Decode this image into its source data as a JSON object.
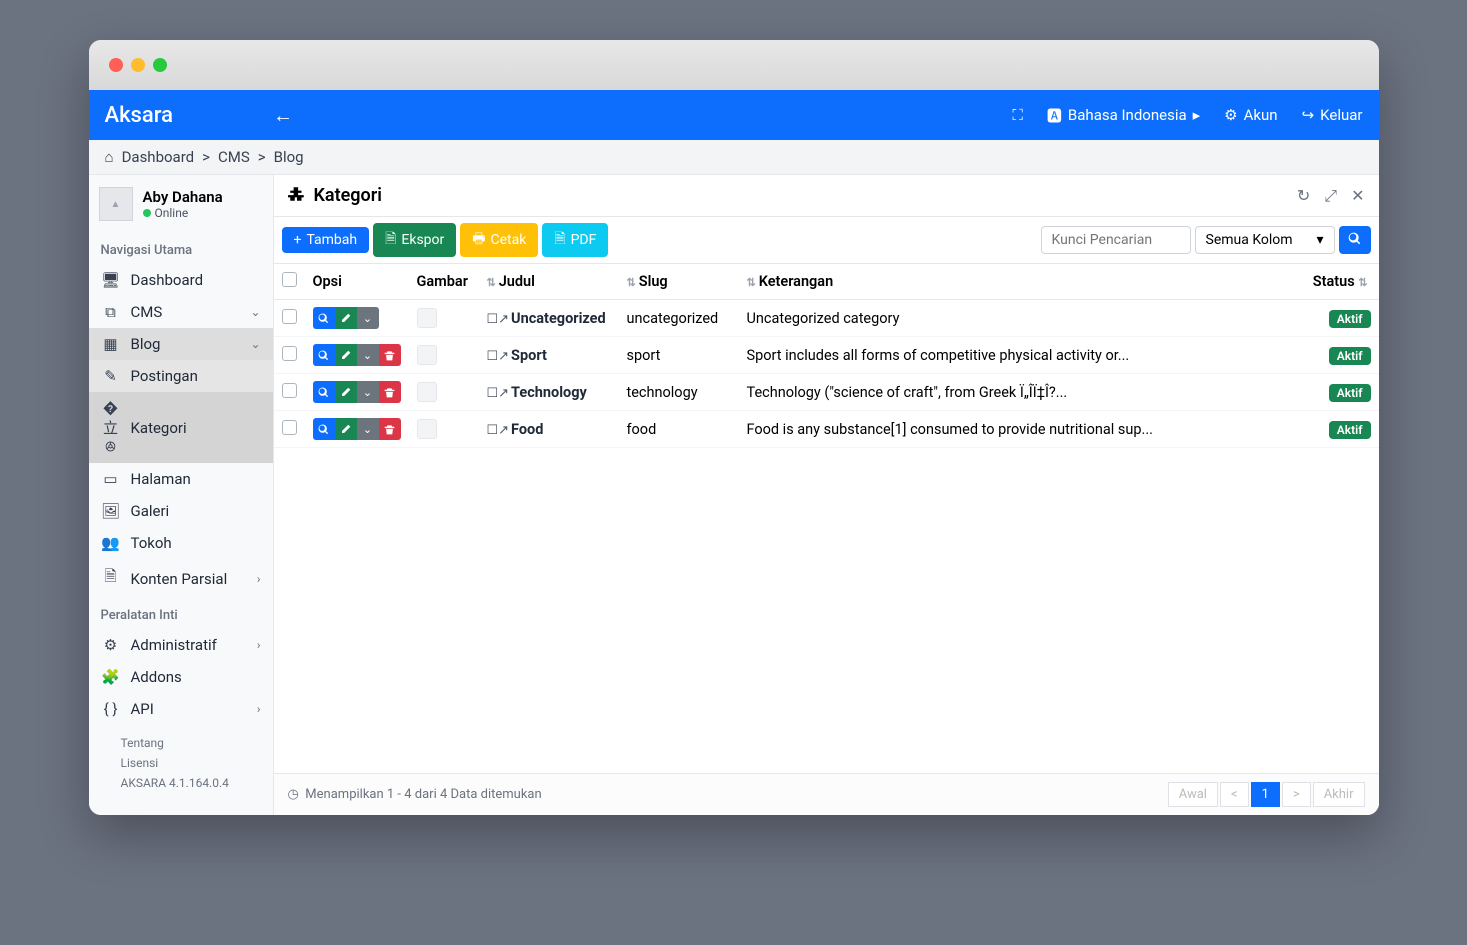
{
  "brand": "Aksara",
  "topbar": {
    "language": "Bahasa Indonesia",
    "account": "Akun",
    "logout": "Keluar"
  },
  "breadcrumb": {
    "dashboard": "Dashboard",
    "cms": "CMS",
    "blog": "Blog"
  },
  "user": {
    "name": "Aby Dahana",
    "status": "Online"
  },
  "sidebar": {
    "section_main": "Navigasi Utama",
    "dashboard": "Dashboard",
    "cms": "CMS",
    "blog": "Blog",
    "postingan": "Postingan",
    "kategori": "Kategori",
    "halaman": "Halaman",
    "galeri": "Galeri",
    "tokoh": "Tokoh",
    "konten_parsial": "Konten Parsial",
    "section_tools": "Peralatan Inti",
    "administratif": "Administratif",
    "addons": "Addons",
    "api": "API",
    "tentang": "Tentang",
    "lisensi": "Lisensi",
    "version": "AKSARA 4.1.164.0.4"
  },
  "page": {
    "title": "Kategori"
  },
  "toolbar": {
    "tambah": "Tambah",
    "ekspor": "Ekspor",
    "cetak": "Cetak",
    "pdf": "PDF",
    "search_placeholder": "Kunci Pencarian",
    "column_select": "Semua Kolom"
  },
  "columns": {
    "opsi": "Opsi",
    "gambar": "Gambar",
    "judul": "Judul",
    "slug": "Slug",
    "keterangan": "Keterangan",
    "status": "Status"
  },
  "rows": [
    {
      "title": "Uncategorized",
      "slug": "uncategorized",
      "desc": "Uncategorized category",
      "status": "Aktif",
      "deletable": false
    },
    {
      "title": "Sport",
      "slug": "sport",
      "desc": "Sport includes all forms of competitive physical activity or...",
      "status": "Aktif",
      "deletable": true
    },
    {
      "title": "Technology",
      "slug": "technology",
      "desc": "Technology (\"science of craft\", from Greek Ï„ÎÏ‡Î?...",
      "status": "Aktif",
      "deletable": true
    },
    {
      "title": "Food",
      "slug": "food",
      "desc": "Food is any substance[1] consumed to provide nutritional sup...",
      "status": "Aktif",
      "deletable": true
    }
  ],
  "footer": {
    "info": "Menampilkan 1 - 4 dari 4 Data ditemukan",
    "awal": "Awal",
    "prev": "<",
    "page": "1",
    "next": ">",
    "akhir": "Akhir"
  }
}
